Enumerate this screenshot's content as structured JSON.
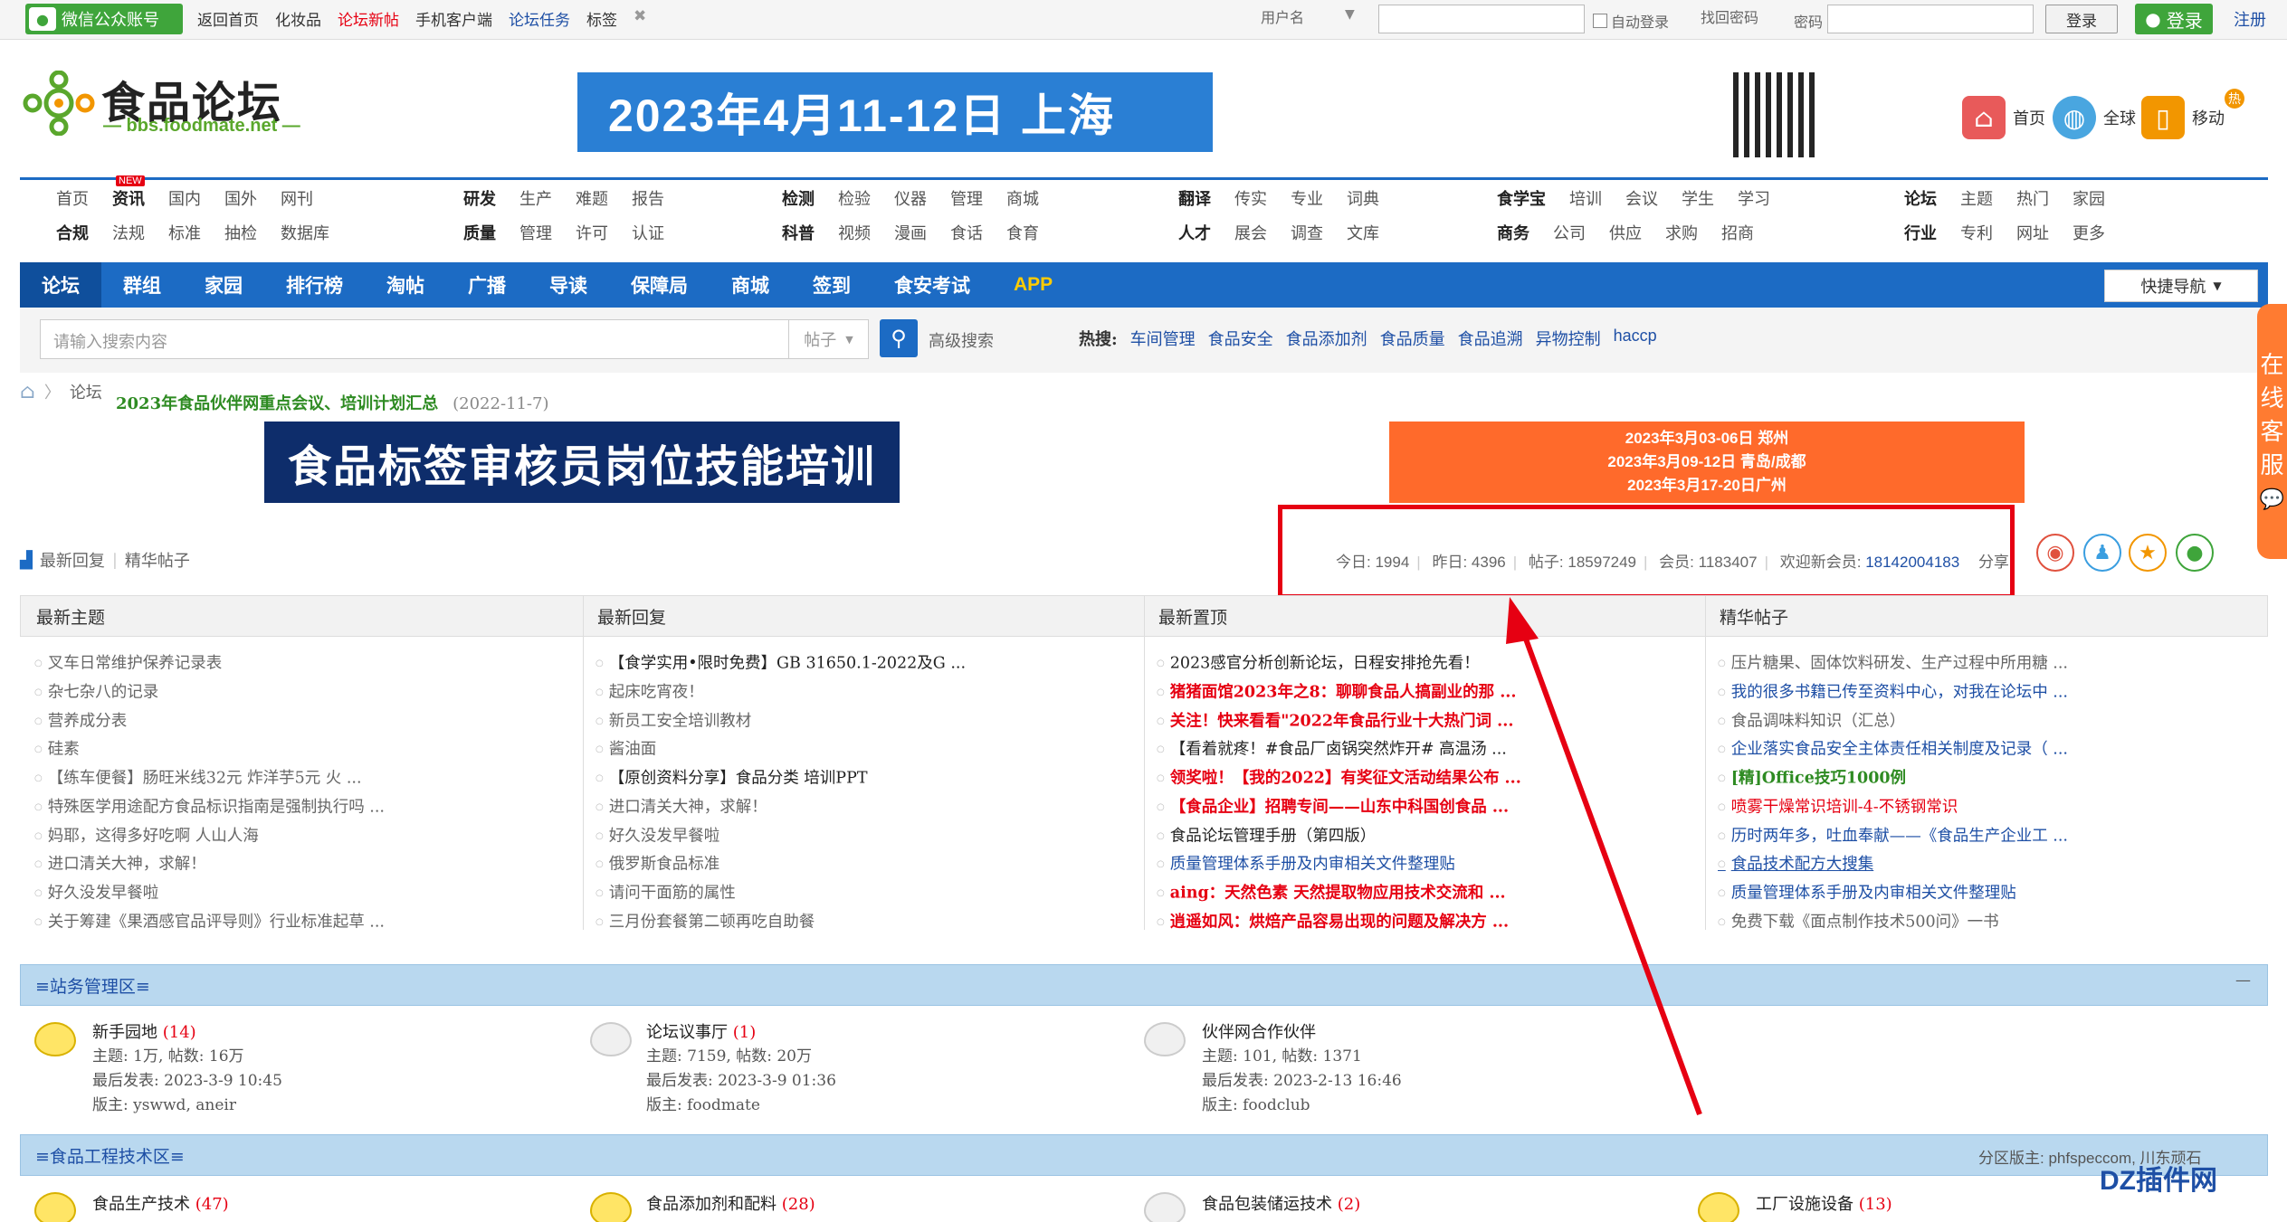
{
  "topbar": {
    "wechat": "微信公众账号",
    "links": [
      "返回首页",
      "化妆品",
      "论坛新帖",
      "手机客户端",
      "论坛任务",
      "标签"
    ],
    "username_label": "用户名",
    "auto_login": "自动登录",
    "forgot": "找回密码",
    "password_label": "密码",
    "login_btn": "登录",
    "login_green": "登录",
    "register": "注册"
  },
  "header": {
    "logo_cn": "食品论坛",
    "logo_en": "— bbs.foodmate.net —",
    "banner": "2023年4月11-12日  上海",
    "links": [
      {
        "icon": "home-icon",
        "label": "首页"
      },
      {
        "icon": "globe-icon",
        "label": "全球"
      },
      {
        "icon": "mobile-icon",
        "label": "移动"
      }
    ],
    "hot_badge": "热"
  },
  "catnav": {
    "groups": [
      {
        "row1": [
          "首页",
          "资讯",
          "国内",
          "国外",
          "网刊"
        ],
        "row2": [
          "合规",
          "法规",
          "标准",
          "抽检",
          "数据库"
        ],
        "new_badge": "NEW"
      },
      {
        "row1": [
          "研发",
          "生产",
          "难题",
          "报告"
        ],
        "row2": [
          "质量",
          "管理",
          "许可",
          "认证"
        ]
      },
      {
        "row1": [
          "检测",
          "检验",
          "仪器",
          "管理",
          "商城"
        ],
        "row2": [
          "科普",
          "视频",
          "漫画",
          "食话",
          "食育"
        ]
      },
      {
        "row1": [
          "翻译",
          "传实",
          "专业",
          "词典"
        ],
        "row2": [
          "人才",
          "展会",
          "调查",
          "文库"
        ]
      },
      {
        "row1": [
          "食学宝",
          "培训",
          "会议",
          "学生",
          "学习"
        ],
        "row2": [
          "商务",
          "公司",
          "供应",
          "求购",
          "招商"
        ]
      },
      {
        "row1": [
          "论坛",
          "主题",
          "热门",
          "家园"
        ],
        "row2": [
          "行业",
          "专利",
          "网址",
          "更多"
        ]
      }
    ]
  },
  "bluenav": {
    "items": [
      "论坛",
      "群组",
      "家园",
      "排行榜",
      "淘帖",
      "广播",
      "导读",
      "保障局",
      "商城",
      "签到",
      "食安考试",
      "APP"
    ],
    "quick": "快捷导航"
  },
  "search": {
    "placeholder": "请输入搜索内容",
    "type": "帖子",
    "advanced": "高级搜索",
    "hot_label": "热搜:",
    "hot": [
      "车间管理",
      "食品安全",
      "食品添加剂",
      "食品质量",
      "食品追溯",
      "异物控制",
      "haccp"
    ]
  },
  "breadcrumb": {
    "current": "论坛"
  },
  "announce": {
    "text": "2023年食品伙伴网重点会议、培训计划汇总",
    "date": "(2022-11-7)"
  },
  "banners": {
    "left": "食品标签审核员岗位技能培训",
    "right": [
      "2023年3月03-06日  郑州",
      "2023年3月09-12日  青岛/成都",
      "2023年3月17-20日广州"
    ]
  },
  "recent": {
    "a": "最新回复",
    "b": "精华帖子"
  },
  "stats": {
    "today_label": "今日:",
    "today": "1994",
    "yesterday_label": "昨日:",
    "yesterday": "4396",
    "posts_label": "帖子:",
    "posts": "18597249",
    "members_label": "会员:",
    "members": "1183407",
    "welcome": "欢迎新会员:",
    "newest": "18142004183",
    "share": "分享:"
  },
  "columns": [
    {
      "title": "最新主题",
      "items": [
        {
          "t": "叉车日常维护保养记录表",
          "c": "gy"
        },
        {
          "t": "杂七杂八的记录",
          "c": "gy"
        },
        {
          "t": "营养成分表",
          "c": "gy"
        },
        {
          "t": "硅素",
          "c": "gy"
        },
        {
          "t": "【练车便餐】肠旺米线32元 炸洋芋5元 火 ...",
          "c": "gy"
        },
        {
          "t": "特殊医学用途配方食品标识指南是强制执行吗 ...",
          "c": "gy"
        },
        {
          "t": "妈耶，这得多好吃啊 人山人海",
          "c": "gy"
        },
        {
          "t": "进口清关大神，求解！",
          "c": "gy"
        },
        {
          "t": "好久没发早餐啦",
          "c": "gy"
        },
        {
          "t": "关于筹建《果酒感官品评导则》行业标准起草 ...",
          "c": "gy"
        }
      ]
    },
    {
      "title": "最新回复",
      "items": [
        {
          "t": "【食学实用•限时免费】GB 31650.1-2022及G ...",
          "c": "bk"
        },
        {
          "t": "起床吃宵夜！",
          "c": "gy"
        },
        {
          "t": "新员工安全培训教材",
          "c": "gy"
        },
        {
          "t": "酱油面",
          "c": "gy"
        },
        {
          "t": "【原创资料分享】食品分类 培训PPT",
          "c": "bk"
        },
        {
          "t": "进口清关大神，求解！",
          "c": "gy"
        },
        {
          "t": "好久没发早餐啦",
          "c": "gy"
        },
        {
          "t": "俄罗斯食品标准",
          "c": "gy"
        },
        {
          "t": "请问干面筋的属性",
          "c": "gy"
        },
        {
          "t": "三月份套餐第二顿再吃自助餐",
          "c": "gy"
        }
      ]
    },
    {
      "title": "最新置顶",
      "items": [
        {
          "t": "2023感官分析创新论坛，日程安排抢先看！",
          "c": "bk"
        },
        {
          "t": "猪猪面馆2023年之8：聊聊食品人搞副业的那 ...",
          "c": "rb"
        },
        {
          "t": "关注！快来看看\"2022年食品行业十大热门词 ...",
          "c": "rb"
        },
        {
          "t": "【看着就疼！#食品厂卤锅突然炸开# 高温汤 ...",
          "c": "bk"
        },
        {
          "t": "领奖啦！【我的2022】有奖征文活动结果公布 ...",
          "c": "rb"
        },
        {
          "t": "【食品企业】招聘专间——山东中科国创食品 ...",
          "c": "rb"
        },
        {
          "t": "食品论坛管理手册（第四版）",
          "c": "bk"
        },
        {
          "t": "质量管理体系手册及内审相关文件整理贴",
          "c": "bl"
        },
        {
          "t": "aing：天然色素 天然提取物应用技术交流和 ...",
          "c": "rb"
        },
        {
          "t": "逍遥如风：烘焙产品容易出现的问题及解决方 ...",
          "c": "rb"
        }
      ]
    },
    {
      "title": "精华帖子",
      "items": [
        {
          "t": "压片糖果、固体饮料研发、生产过程中所用糖 ...",
          "c": "gy"
        },
        {
          "t": "我的很多书籍已传至资料中心，对我在论坛中 ...",
          "c": "bl"
        },
        {
          "t": "食品调味料知识（汇总）",
          "c": "gy"
        },
        {
          "t": "企业落实食品安全主体责任相关制度及记录（ ...",
          "c": "bl"
        },
        {
          "t": "[精]Office技巧1000例",
          "c": "gr"
        },
        {
          "t": "喷雾干燥常识培训-4-不锈钢常识",
          "c": "red"
        },
        {
          "t": "历时两年多，吐血奉献——《食品生产企业工 ...",
          "c": "bl"
        },
        {
          "t": "食品技术配方大搜集",
          "c": "ul"
        },
        {
          "t": "质量管理体系手册及内审相关文件整理贴",
          "c": "bl"
        },
        {
          "t": "免费下载《面点制作技术500问》一书",
          "c": "gy"
        }
      ]
    }
  ],
  "section1": {
    "title": "≡站务管理区≡",
    "collapse": "—",
    "forums": [
      {
        "name": "新手园地",
        "count": "(14)",
        "topics": "主题: 1万, 帖数: 16万",
        "last": "最后发表: 2023-3-9 10:45",
        "mods": "版主: yswwd, aneir"
      },
      {
        "name": "论坛议事厅",
        "count": "(1)",
        "topics": "主题: 7159, 帖数: 20万",
        "last": "最后发表: 2023-3-9 01:36",
        "mods": "版主: foodmate"
      },
      {
        "name": "伙伴网合作伙伴",
        "count": "",
        "topics": "主题: 101, 帖数: 1371",
        "last": "最后发表: 2023-2-13 16:46",
        "mods": "版主: foodclub"
      }
    ]
  },
  "section2": {
    "title": "≡食品工程技术区≡",
    "mods": "分区版主: phfspeccom, 川东顽石",
    "forums": [
      {
        "name": "食品生产技术",
        "count": "(47)"
      },
      {
        "name": "食品添加剂和配料",
        "count": "(28)"
      },
      {
        "name": "食品包装储运技术",
        "count": "(2)"
      },
      {
        "name": "工厂设施设备",
        "count": "(13)"
      }
    ]
  },
  "service": [
    "在",
    "线",
    "客",
    "服"
  ],
  "watermark": "DZ插件网"
}
